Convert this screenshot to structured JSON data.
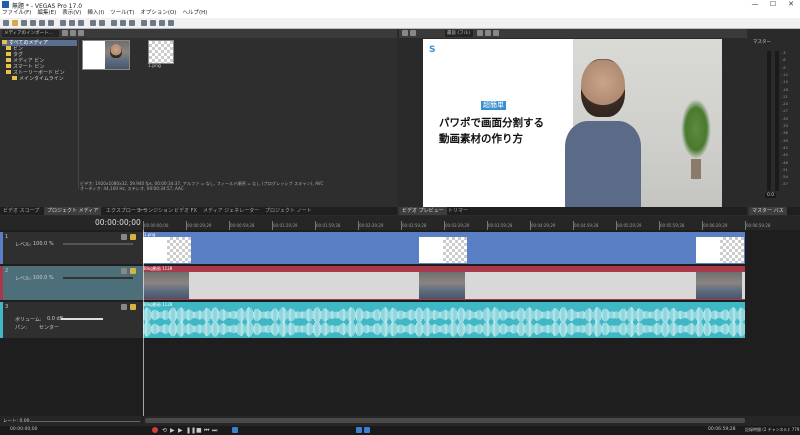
{
  "window": {
    "title": "無題 * - VEGAS Pro 17.0",
    "minimize": "—",
    "maximize": "☐",
    "close": "✕"
  },
  "menu": [
    "ファイル(F)",
    "編集(E)",
    "表示(V)",
    "挿入(I)",
    "ツール(T)",
    "オプション(O)",
    "ヘルプ(H)"
  ],
  "media_panel": {
    "dropdown": "メディアのインポート...",
    "tree": [
      "すべてのメディア",
      "ビン",
      "タグ",
      "メディア ビン",
      "スマート ビン",
      "ストーリーボード ビン",
      "メインタイムライン"
    ],
    "items": [
      {
        "label": "",
        "kind": "image"
      },
      {
        "label": "1.png",
        "kind": "png"
      }
    ],
    "info_line1": "ビデオ: 1920x1080x32, 59.940 fps, 00:00:34:37, アルファ = なし, フィールド順序 = なし (プログレッシブ スキャン), AVC",
    "info_line2": "オーディオ: 44,100 Hz, ステレオ, 00:00:34:57, AAC",
    "tabs": [
      "ビデオ スコープ",
      "プロジェクト メディア",
      "エクスプローラー",
      "トランジション",
      "ビデオ FX",
      "メディア ジェネレーター",
      "プロジェクト ノート"
    ]
  },
  "preview": {
    "toolbar_label": "最良 (フル)",
    "badge": "超簡単",
    "title_line1": "パワポで画面分割する",
    "title_line2": "動画素材の作り方",
    "logo": "S",
    "tabs": [
      "ビデオ プレビュー",
      "トリマー"
    ]
  },
  "master": {
    "label": "マスター",
    "db_values": [
      "-3",
      "-6",
      "-9",
      "-12",
      "-15",
      "-18",
      "-21",
      "-24",
      "-27",
      "-30",
      "-33",
      "-36",
      "-39",
      "-42",
      "-45",
      "-48",
      "-51",
      "-54",
      "-57"
    ],
    "readout": "0.0",
    "tab": "マスター バス"
  },
  "timeline": {
    "timecode": "00:00:00;00",
    "ruler": [
      "00:00:00;00",
      "00:00:29;29",
      "00:00:59;28",
      "00:01:29;29",
      "00:01:59;28",
      "00:02:29;29",
      "00:02:59;28",
      "00:03:29;29",
      "00:03:59;28",
      "00:04:29;29",
      "00:04:59;28",
      "00:05:29;29",
      "00:05:59;28",
      "00:06:29;29",
      "00:06:59;28"
    ],
    "tracks": [
      {
        "num": "1",
        "level_label": "レベル:",
        "level": "100.0 %",
        "clip": "1.png",
        "color": "#5a7fc4"
      },
      {
        "num": "2",
        "level_label": "レベル:",
        "level": "100.0 %",
        "clip": "Blog動画 1128",
        "color": "#a8384a"
      },
      {
        "num": "3",
        "vol_label": "ボリューム:",
        "vol": "0.0 dB",
        "pan_label": "パン:",
        "pan": "センター",
        "clip": "Blog動画 1128",
        "color": "#3fb7c4"
      }
    ],
    "rate": "レート: 0.00",
    "bottom_time": "00:00:00;00",
    "end_time": "00:06:59;28",
    "record_time": "記録時間 (2 チャンネル): 779:36:05"
  }
}
